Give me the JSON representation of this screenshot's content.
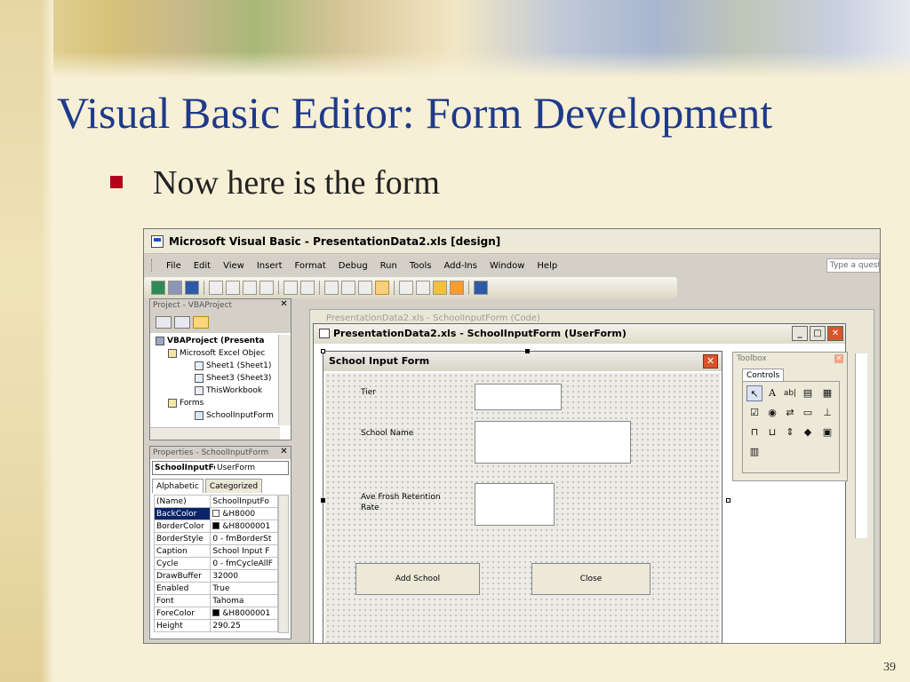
{
  "slide": {
    "title": "Visual Basic Editor: Form Development",
    "bullet": "Now here is the form",
    "page_number": "39"
  },
  "app": {
    "window_title": "Microsoft Visual Basic - PresentationData2.xls [design]",
    "menu": [
      "File",
      "Edit",
      "View",
      "Insert",
      "Format",
      "Debug",
      "Run",
      "Tools",
      "Add-Ins",
      "Window",
      "Help"
    ],
    "help_placeholder": "Type a questi"
  },
  "project": {
    "title": "Project - VBAProject",
    "tree": [
      {
        "label": "VBAProject (Presenta",
        "level": 0,
        "bold": true,
        "icon": "project-icon"
      },
      {
        "label": "Microsoft Excel Objec",
        "level": 1,
        "bold": false,
        "icon": "folder-icon"
      },
      {
        "label": "Sheet1 (Sheet1)",
        "level": 2,
        "bold": false,
        "icon": "sheet-icon"
      },
      {
        "label": "Sheet3 (Sheet3)",
        "level": 2,
        "bold": false,
        "icon": "sheet-icon"
      },
      {
        "label": "ThisWorkbook",
        "level": 2,
        "bold": false,
        "icon": "workbook-icon"
      },
      {
        "label": "Forms",
        "level": 1,
        "bold": false,
        "icon": "folder-icon"
      },
      {
        "label": "SchoolInputForm",
        "level": 2,
        "bold": false,
        "icon": "form-icon"
      }
    ]
  },
  "properties": {
    "title": "Properties - SchoolInputForm",
    "object_name": "SchoolInputFo",
    "object_type": "UserForm",
    "tabs": [
      "Alphabetic",
      "Categorized"
    ],
    "rows": [
      {
        "name": "(Name)",
        "value": "SchoolInputFo"
      },
      {
        "name": "BackColor",
        "value": "&H8000"
      },
      {
        "name": "BorderColor",
        "value": "&H8000001"
      },
      {
        "name": "BorderStyle",
        "value": "0 - fmBorderSt"
      },
      {
        "name": "Caption",
        "value": "School Input F"
      },
      {
        "name": "Cycle",
        "value": "0 - fmCycleAllF"
      },
      {
        "name": "DrawBuffer",
        "value": "32000"
      },
      {
        "name": "Enabled",
        "value": "True"
      },
      {
        "name": "Font",
        "value": "Tahoma"
      },
      {
        "name": "ForeColor",
        "value": "&H8000001"
      },
      {
        "name": "Height",
        "value": "290.25"
      }
    ]
  },
  "code_window": {
    "title": "PresentationData2.xls - SchoolInputForm (Code)"
  },
  "userform_window": {
    "title": "PresentationData2.xls - SchoolInputForm (UserForm)"
  },
  "form": {
    "caption": "School Input Form",
    "labels": {
      "tier": "Tier",
      "school_name": "School Name",
      "retention": "Ave Frosh Retention Rate"
    },
    "buttons": {
      "add": "Add School",
      "close": "Close"
    }
  },
  "toolbox": {
    "title": "Toolbox",
    "tab": "Controls"
  }
}
